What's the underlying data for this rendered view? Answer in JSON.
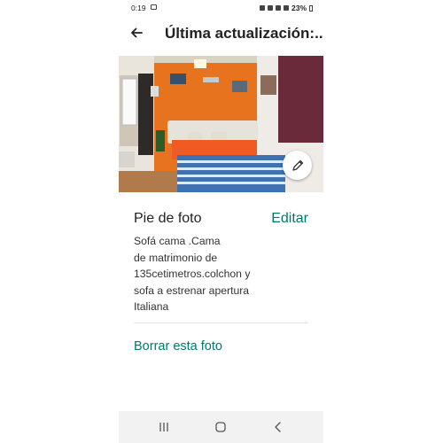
{
  "status_bar": {
    "time": "0:19",
    "battery": "23%"
  },
  "app_bar": {
    "title": "Última actualización:..."
  },
  "caption": {
    "heading": "Pie de foto",
    "edit_label": "Editar",
    "lines": [
      "Sofá cama .Cama",
      "de matrimonio de",
      "135cetimetros.colchon y",
      "sofa a estrenar apertura",
      "Italiana"
    ]
  },
  "actions": {
    "delete_label": "Borrar esta foto"
  },
  "icons": {
    "back": "back-arrow-icon",
    "edit": "pencil-icon",
    "nav_recents": "recents-icon",
    "nav_home": "home-icon",
    "nav_back": "back-chevron-icon"
  },
  "colors": {
    "accent": "#00796b",
    "wall": "#e8731f",
    "text": "#222222"
  }
}
